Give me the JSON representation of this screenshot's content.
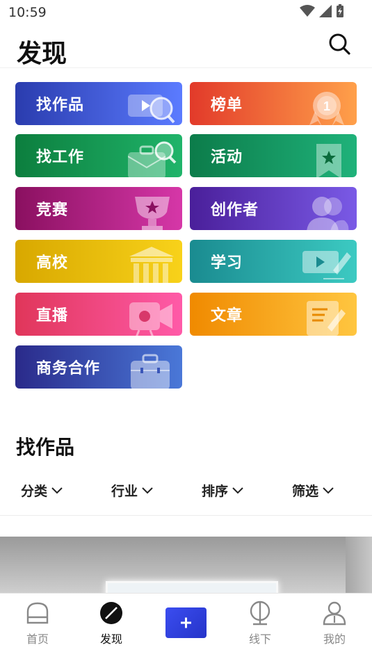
{
  "status": {
    "time": "10:59"
  },
  "header": {
    "title": "发现"
  },
  "categories": [
    {
      "label": "找作品",
      "icon": "video-search-icon"
    },
    {
      "label": "榜单",
      "icon": "medal-icon"
    },
    {
      "label": "找工作",
      "icon": "briefcase-search-icon"
    },
    {
      "label": "活动",
      "icon": "bookmark-star-icon"
    },
    {
      "label": "竞赛",
      "icon": "trophy-icon"
    },
    {
      "label": "创作者",
      "icon": "users-icon"
    },
    {
      "label": "高校",
      "icon": "university-icon"
    },
    {
      "label": "学习",
      "icon": "video-edit-icon"
    },
    {
      "label": "直播",
      "icon": "camera-icon"
    },
    {
      "label": "文章",
      "icon": "document-edit-icon"
    },
    {
      "label": "商务合作",
      "icon": "suitcase-icon"
    }
  ],
  "colors": {
    "c0": [
      "#2a3cae",
      "#5b7bff"
    ],
    "c1": [
      "#e23a2a",
      "#ffa04a"
    ],
    "c2": [
      "#0c7e3e",
      "#20b46a"
    ],
    "c3": [
      "#0c7c4a",
      "#1fb27a"
    ],
    "c4": [
      "#8a1060",
      "#d637a8"
    ],
    "c5": [
      "#4a1f9a",
      "#7a5ae6"
    ],
    "c6": [
      "#d8a800",
      "#f8d21a"
    ],
    "c7": [
      "#1a8b90",
      "#3ccac2"
    ],
    "c8": [
      "#e0365a",
      "#ff5aa8"
    ],
    "c9": [
      "#f08a00",
      "#ffc640"
    ],
    "c10": [
      "#2a2a8a",
      "#4a78d8"
    ]
  },
  "section": {
    "title": "找作品",
    "filters": [
      "分类",
      "行业",
      "排序",
      "筛选"
    ]
  },
  "tabbar": {
    "items": [
      "首页",
      "发现",
      "线下",
      "我的"
    ],
    "add_symbol": "+"
  }
}
